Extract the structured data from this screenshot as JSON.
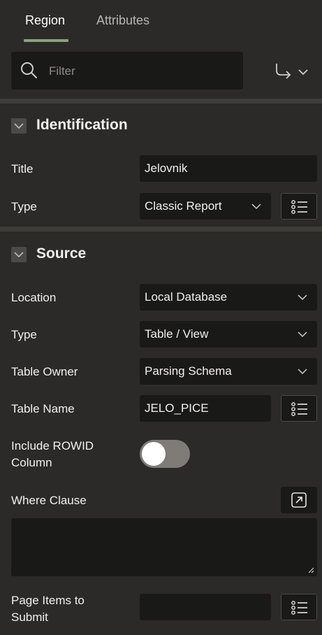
{
  "tabs": [
    {
      "label": "Region",
      "active": true
    },
    {
      "label": "Attributes",
      "active": false
    }
  ],
  "filter": {
    "placeholder": "Filter"
  },
  "colors": {
    "accent": "#8ea07f",
    "background": "#2b2a28",
    "field": "#191918"
  },
  "sections": {
    "identification": {
      "title": "Identification",
      "title_label": "Title",
      "title_value": "Jelovnik",
      "type_label": "Type",
      "type_value": "Classic Report"
    },
    "source": {
      "title": "Source",
      "location_label": "Location",
      "location_value": "Local Database",
      "type_label": "Type",
      "type_value": "Table / View",
      "table_owner_label": "Table Owner",
      "table_owner_value": "Parsing Schema",
      "table_name_label": "Table Name",
      "table_name_value": "JELO_PICE",
      "include_rowid_label_line1": "Include ROWID",
      "include_rowid_label_line2": "Column",
      "include_rowid_on": false,
      "where_clause_label": "Where Clause",
      "where_clause_value": "",
      "page_items_label_line1": "Page Items to",
      "page_items_label_line2": "Submit",
      "page_items_value": ""
    }
  }
}
